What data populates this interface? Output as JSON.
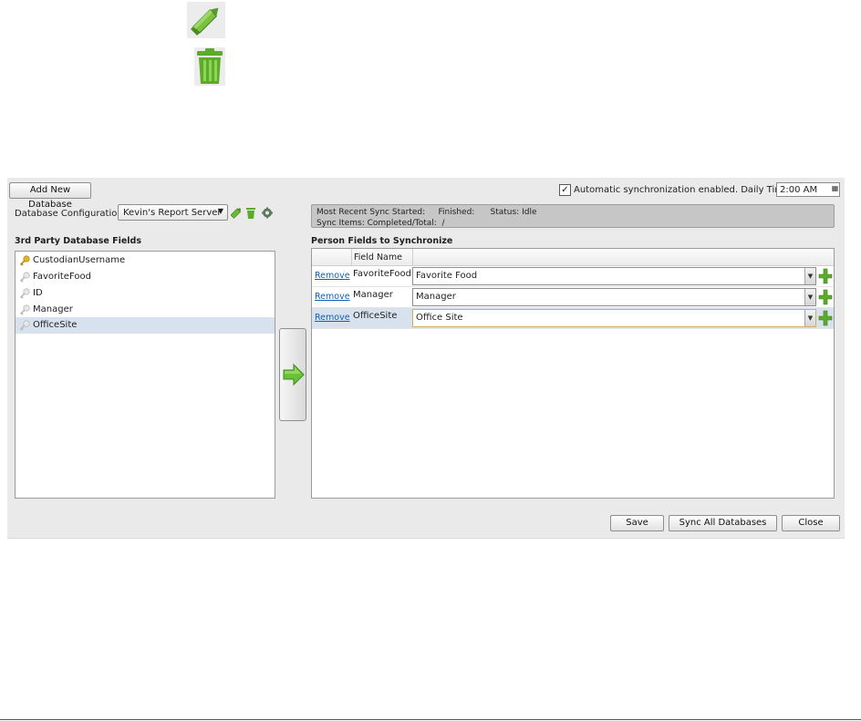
{
  "icons": {
    "pencil": "pencil-icon",
    "trash": "trash-icon",
    "add": "plus-icon",
    "move": "arrow-right-icon",
    "key": "key-icon",
    "gear": "gear-icon"
  },
  "toolbar": {
    "add_database_label": "Add New Database"
  },
  "auto_sync": {
    "checked": true,
    "check_mark": "✓",
    "label": "Automatic synchronization enabled. Daily Time:",
    "time_value": "2:00 AM",
    "time_button": "▦"
  },
  "db_config": {
    "label": "Database Configuration:",
    "selected": "Kevin's Report Server",
    "arrow": "▼"
  },
  "status": {
    "line1": "Most Recent Sync Started:     Finished:      Status: Idle",
    "line2": "Sync Items: Completed/Total:  /"
  },
  "left_panel": {
    "title": "3rd Party Database Fields",
    "fields": [
      {
        "name": "CustodianUsername",
        "key_gold": true,
        "selected": false
      },
      {
        "name": "FavoriteFood",
        "key_gold": false,
        "selected": false
      },
      {
        "name": "ID",
        "key_gold": false,
        "selected": false
      },
      {
        "name": "Manager",
        "key_gold": false,
        "selected": false
      },
      {
        "name": "OfficeSite",
        "key_gold": false,
        "selected": true
      }
    ]
  },
  "right_panel": {
    "title": "Person Fields to Synchronize",
    "column_field_name": "Field Name",
    "remove_label": "Remove",
    "rows": [
      {
        "field": "FavoriteFood",
        "value": "Favorite Food",
        "selected": false
      },
      {
        "field": "Manager",
        "value": "Manager",
        "selected": false
      },
      {
        "field": "OfficeSite",
        "value": "Office Site",
        "selected": true
      }
    ]
  },
  "footer": {
    "save_label": "Save",
    "sync_all_label": "Sync All Databases",
    "close_label": "Close"
  },
  "colors": {
    "green": "#5cac2a",
    "link": "#1060b0",
    "selection": "#d8e2ee"
  }
}
